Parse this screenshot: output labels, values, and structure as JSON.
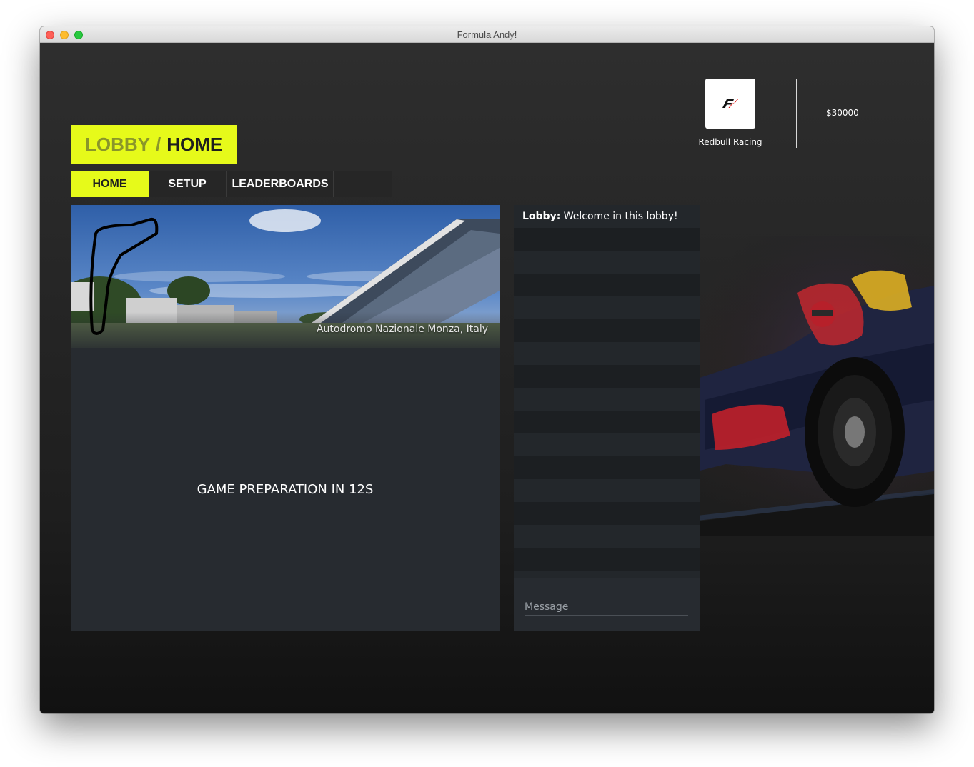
{
  "window": {
    "title": "Formula Andy!"
  },
  "header": {
    "breadcrumb_section": "LOBBY",
    "breadcrumb_separator": "/",
    "breadcrumb_current": "HOME",
    "team_name": "Redbull Racing",
    "team_logo_icon": "f1-logo-icon",
    "money": "$30000"
  },
  "tabs": [
    {
      "label": "HOME",
      "active": true
    },
    {
      "label": "SETUP",
      "active": false
    },
    {
      "label": "LEADERBOARDS",
      "active": false
    },
    {
      "label": "",
      "active": false
    }
  ],
  "track": {
    "caption": "Autodromo Nazionale Monza, Italy",
    "image": "monza-grandstand-photo"
  },
  "status": {
    "countdown": "GAME PREPARATION IN 12S"
  },
  "chat": {
    "messages": [
      {
        "sender": "Lobby:",
        "text": "Welcome in this lobby!"
      }
    ],
    "input_placeholder": "Message"
  },
  "colors": {
    "accent": "#e6fa1a",
    "panel": "#272b30",
    "chat_panel": "#1b1e21"
  }
}
